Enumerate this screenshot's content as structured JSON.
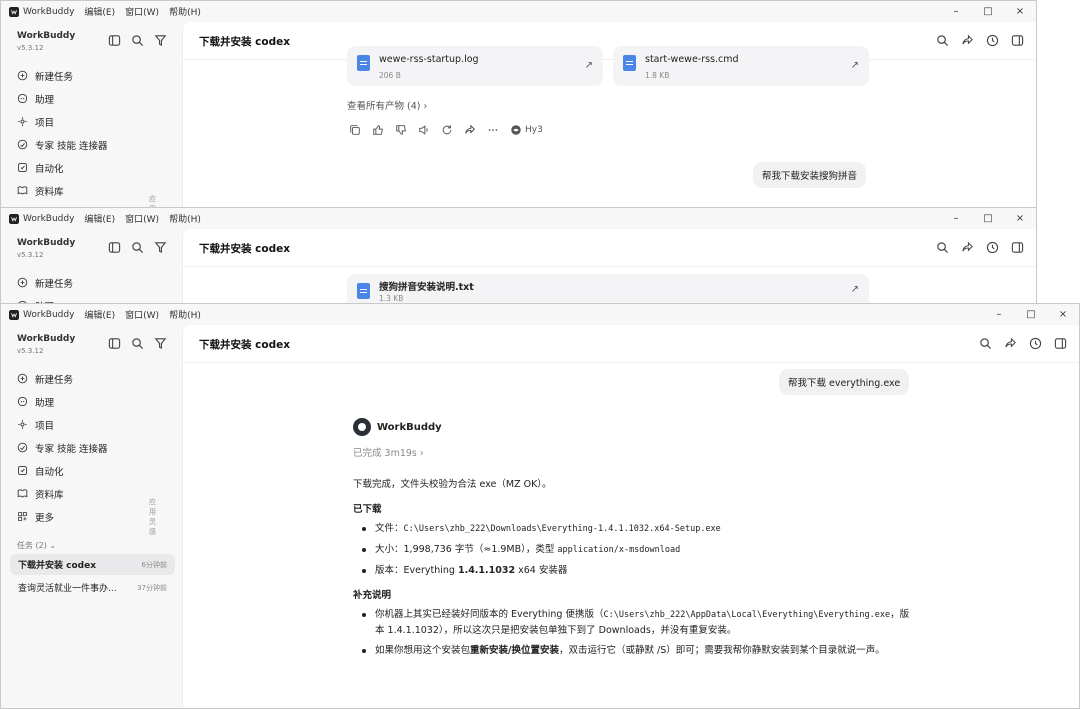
{
  "app": {
    "name": "WorkBuddy",
    "version": "v5.3.12",
    "menu": [
      "编辑(E)",
      "窗口(W)",
      "帮助(H)"
    ],
    "controls": [
      "–",
      "□",
      "×"
    ]
  },
  "sidebar": {
    "nav": [
      {
        "label": "新建任务",
        "icon": "plus-circle-icon"
      },
      {
        "label": "助理",
        "icon": "assistant-icon"
      },
      {
        "label": "项目",
        "icon": "project-icon"
      },
      {
        "label": "专家 技能 连接器",
        "icon": "expert-icon"
      },
      {
        "label": "自动化",
        "icon": "automation-icon"
      },
      {
        "label": "资料库",
        "icon": "library-icon"
      },
      {
        "label": "更多",
        "icon": "more-grid-icon",
        "extra": "应用 灵感"
      }
    ],
    "tasks_header": "任务 (2)",
    "tasks": [
      {
        "title": "下载并安装 codex",
        "time": "6分钟前",
        "active": true
      },
      {
        "title": "查询灵活就业一件事办...",
        "time": "37分钟前",
        "active": false
      }
    ]
  },
  "main": {
    "title": "下载并安装 codex"
  },
  "win1": {
    "files": [
      {
        "name": "wewe-rss-startup.log",
        "size": "206 B"
      },
      {
        "name": "start-wewe-rss.cmd",
        "size": "1.8 KB"
      }
    ],
    "view_all": "查看所有产物 (4)",
    "model": "Hy3",
    "user_message": "帮我下载安装搜狗拼音"
  },
  "win2": {
    "file": {
      "name": "搜狗拼音安装说明.txt",
      "size": "1.3 KB"
    }
  },
  "win3": {
    "user_message": "帮我下载 everything.exe",
    "agent_name": "WorkBuddy",
    "status": "已完成 3m19s",
    "intro": "下载完成，文件头校验为合法 exe（MZ OK）。",
    "downloaded_heading": "已下载",
    "file_label": "文件：",
    "file_path": "C:\\Users\\zhb_222\\Downloads\\Everything-1.4.1.1032.x64-Setup.exe",
    "size_label": "大小：1,998,736 字节（≈1.9MB），类型 ",
    "mime": "application/x-msdownload",
    "version_label": "版本：Everything ",
    "version_value": "1.4.1.1032",
    "version_suffix": " x64 安装器",
    "notes_heading": "补充说明",
    "note1_a": "你机器上其实已经装好同版本的 Everything 便携版（",
    "note1_path": "C:\\Users\\zhb_222\\AppData\\Local\\Everything\\Everything.exe",
    "note1_b": "，版本 1.4.1.1032），所以这次只是把安装包单独下到了 Downloads，并没有重复安装。",
    "note2_a": "如果你想用这个安装包",
    "note2_bold": "重新安装/换位置安装",
    "note2_b": "，双击运行它（或静默 /S）即可；需要我帮你静默安装到某个目录就说一声。"
  },
  "colors": {
    "accent_file": "#4a86e8",
    "sidebar_bg": "#f7f7f8",
    "active_task": "#e9e9eb"
  }
}
